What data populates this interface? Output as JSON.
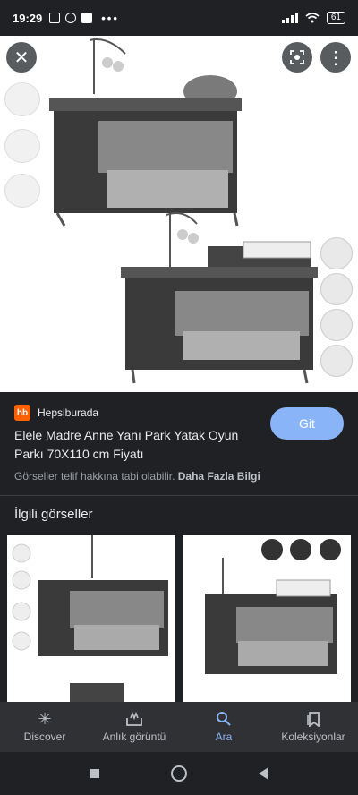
{
  "status_bar": {
    "time": "19:29",
    "battery": "61"
  },
  "hero": {
    "close_icon": "close-icon",
    "lens_icon": "lens-icon",
    "more_icon": "more-vert-icon"
  },
  "result": {
    "source_logo": "hb",
    "source": "Hepsiburada",
    "title": "Elele Madre Anne Yanı Park Yatak Oyun Parkı 70X110 cm Fiyatı",
    "visit_label": "Git",
    "copyright_notice": "Görseller telif hakkına tabi olabilir.",
    "more_info_link": "Daha Fazla Bilgi"
  },
  "related": {
    "heading": "İlgili görseller"
  },
  "bottom_nav": {
    "items": [
      {
        "label": "Discover",
        "icon": "asterisk-icon"
      },
      {
        "label": "Anlık görüntü",
        "icon": "snapshot-icon"
      },
      {
        "label": "Ara",
        "icon": "search-icon"
      },
      {
        "label": "Koleksiyonlar",
        "icon": "bookmark-icon"
      }
    ]
  },
  "colors": {
    "accent": "#8ab4f8",
    "background": "#202124",
    "brand_hb": "#ff6000"
  }
}
